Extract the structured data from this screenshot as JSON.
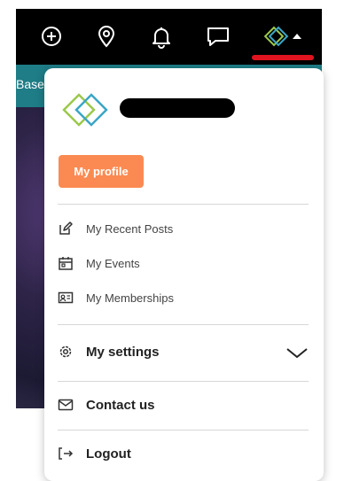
{
  "topbar": {
    "icons": [
      "plus-circle-icon",
      "location-pin-icon",
      "bell-icon",
      "chat-bubble-icon",
      "brand-logo-icon",
      "caret-up-icon"
    ]
  },
  "background": {
    "peek_text": "Base"
  },
  "user_menu": {
    "profile_button": "My profile",
    "items": [
      {
        "label": "My Recent Posts",
        "icon": "edit-icon"
      },
      {
        "label": "My Events",
        "icon": "calendar-icon"
      },
      {
        "label": "My Memberships",
        "icon": "id-card-icon"
      }
    ],
    "settings_label": "My settings",
    "contact_label": "Contact us",
    "logout_label": "Logout"
  },
  "colors": {
    "accent": "#fb8a52",
    "active_indicator": "#e0141e",
    "teal": "#1e7d87",
    "logo_green": "#9cc84b",
    "logo_blue": "#3aa6c6"
  }
}
